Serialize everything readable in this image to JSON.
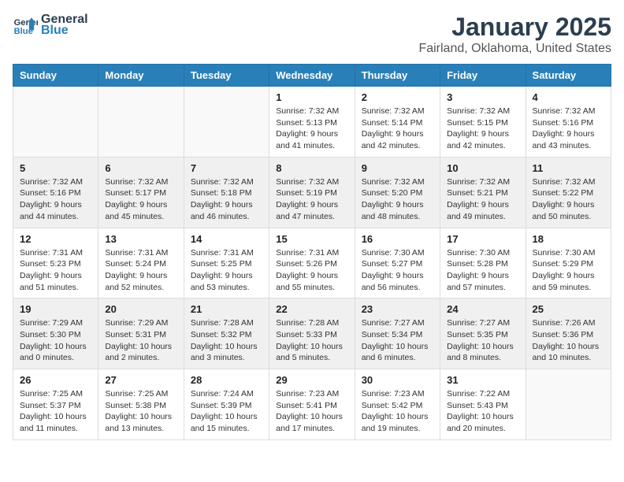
{
  "header": {
    "logo_line1": "General",
    "logo_line2": "Blue",
    "month": "January 2025",
    "location": "Fairland, Oklahoma, United States"
  },
  "weekdays": [
    "Sunday",
    "Monday",
    "Tuesday",
    "Wednesday",
    "Thursday",
    "Friday",
    "Saturday"
  ],
  "weeks": [
    [
      {
        "day": "",
        "sunrise": "",
        "sunset": "",
        "daylight": ""
      },
      {
        "day": "",
        "sunrise": "",
        "sunset": "",
        "daylight": ""
      },
      {
        "day": "",
        "sunrise": "",
        "sunset": "",
        "daylight": ""
      },
      {
        "day": "1",
        "sunrise": "Sunrise: 7:32 AM",
        "sunset": "Sunset: 5:13 PM",
        "daylight": "Daylight: 9 hours and 41 minutes."
      },
      {
        "day": "2",
        "sunrise": "Sunrise: 7:32 AM",
        "sunset": "Sunset: 5:14 PM",
        "daylight": "Daylight: 9 hours and 42 minutes."
      },
      {
        "day": "3",
        "sunrise": "Sunrise: 7:32 AM",
        "sunset": "Sunset: 5:15 PM",
        "daylight": "Daylight: 9 hours and 42 minutes."
      },
      {
        "day": "4",
        "sunrise": "Sunrise: 7:32 AM",
        "sunset": "Sunset: 5:16 PM",
        "daylight": "Daylight: 9 hours and 43 minutes."
      }
    ],
    [
      {
        "day": "5",
        "sunrise": "Sunrise: 7:32 AM",
        "sunset": "Sunset: 5:16 PM",
        "daylight": "Daylight: 9 hours and 44 minutes."
      },
      {
        "day": "6",
        "sunrise": "Sunrise: 7:32 AM",
        "sunset": "Sunset: 5:17 PM",
        "daylight": "Daylight: 9 hours and 45 minutes."
      },
      {
        "day": "7",
        "sunrise": "Sunrise: 7:32 AM",
        "sunset": "Sunset: 5:18 PM",
        "daylight": "Daylight: 9 hours and 46 minutes."
      },
      {
        "day": "8",
        "sunrise": "Sunrise: 7:32 AM",
        "sunset": "Sunset: 5:19 PM",
        "daylight": "Daylight: 9 hours and 47 minutes."
      },
      {
        "day": "9",
        "sunrise": "Sunrise: 7:32 AM",
        "sunset": "Sunset: 5:20 PM",
        "daylight": "Daylight: 9 hours and 48 minutes."
      },
      {
        "day": "10",
        "sunrise": "Sunrise: 7:32 AM",
        "sunset": "Sunset: 5:21 PM",
        "daylight": "Daylight: 9 hours and 49 minutes."
      },
      {
        "day": "11",
        "sunrise": "Sunrise: 7:32 AM",
        "sunset": "Sunset: 5:22 PM",
        "daylight": "Daylight: 9 hours and 50 minutes."
      }
    ],
    [
      {
        "day": "12",
        "sunrise": "Sunrise: 7:31 AM",
        "sunset": "Sunset: 5:23 PM",
        "daylight": "Daylight: 9 hours and 51 minutes."
      },
      {
        "day": "13",
        "sunrise": "Sunrise: 7:31 AM",
        "sunset": "Sunset: 5:24 PM",
        "daylight": "Daylight: 9 hours and 52 minutes."
      },
      {
        "day": "14",
        "sunrise": "Sunrise: 7:31 AM",
        "sunset": "Sunset: 5:25 PM",
        "daylight": "Daylight: 9 hours and 53 minutes."
      },
      {
        "day": "15",
        "sunrise": "Sunrise: 7:31 AM",
        "sunset": "Sunset: 5:26 PM",
        "daylight": "Daylight: 9 hours and 55 minutes."
      },
      {
        "day": "16",
        "sunrise": "Sunrise: 7:30 AM",
        "sunset": "Sunset: 5:27 PM",
        "daylight": "Daylight: 9 hours and 56 minutes."
      },
      {
        "day": "17",
        "sunrise": "Sunrise: 7:30 AM",
        "sunset": "Sunset: 5:28 PM",
        "daylight": "Daylight: 9 hours and 57 minutes."
      },
      {
        "day": "18",
        "sunrise": "Sunrise: 7:30 AM",
        "sunset": "Sunset: 5:29 PM",
        "daylight": "Daylight: 9 hours and 59 minutes."
      }
    ],
    [
      {
        "day": "19",
        "sunrise": "Sunrise: 7:29 AM",
        "sunset": "Sunset: 5:30 PM",
        "daylight": "Daylight: 10 hours and 0 minutes."
      },
      {
        "day": "20",
        "sunrise": "Sunrise: 7:29 AM",
        "sunset": "Sunset: 5:31 PM",
        "daylight": "Daylight: 10 hours and 2 minutes."
      },
      {
        "day": "21",
        "sunrise": "Sunrise: 7:28 AM",
        "sunset": "Sunset: 5:32 PM",
        "daylight": "Daylight: 10 hours and 3 minutes."
      },
      {
        "day": "22",
        "sunrise": "Sunrise: 7:28 AM",
        "sunset": "Sunset: 5:33 PM",
        "daylight": "Daylight: 10 hours and 5 minutes."
      },
      {
        "day": "23",
        "sunrise": "Sunrise: 7:27 AM",
        "sunset": "Sunset: 5:34 PM",
        "daylight": "Daylight: 10 hours and 6 minutes."
      },
      {
        "day": "24",
        "sunrise": "Sunrise: 7:27 AM",
        "sunset": "Sunset: 5:35 PM",
        "daylight": "Daylight: 10 hours and 8 minutes."
      },
      {
        "day": "25",
        "sunrise": "Sunrise: 7:26 AM",
        "sunset": "Sunset: 5:36 PM",
        "daylight": "Daylight: 10 hours and 10 minutes."
      }
    ],
    [
      {
        "day": "26",
        "sunrise": "Sunrise: 7:25 AM",
        "sunset": "Sunset: 5:37 PM",
        "daylight": "Daylight: 10 hours and 11 minutes."
      },
      {
        "day": "27",
        "sunrise": "Sunrise: 7:25 AM",
        "sunset": "Sunset: 5:38 PM",
        "daylight": "Daylight: 10 hours and 13 minutes."
      },
      {
        "day": "28",
        "sunrise": "Sunrise: 7:24 AM",
        "sunset": "Sunset: 5:39 PM",
        "daylight": "Daylight: 10 hours and 15 minutes."
      },
      {
        "day": "29",
        "sunrise": "Sunrise: 7:23 AM",
        "sunset": "Sunset: 5:41 PM",
        "daylight": "Daylight: 10 hours and 17 minutes."
      },
      {
        "day": "30",
        "sunrise": "Sunrise: 7:23 AM",
        "sunset": "Sunset: 5:42 PM",
        "daylight": "Daylight: 10 hours and 19 minutes."
      },
      {
        "day": "31",
        "sunrise": "Sunrise: 7:22 AM",
        "sunset": "Sunset: 5:43 PM",
        "daylight": "Daylight: 10 hours and 20 minutes."
      },
      {
        "day": "",
        "sunrise": "",
        "sunset": "",
        "daylight": ""
      }
    ]
  ]
}
